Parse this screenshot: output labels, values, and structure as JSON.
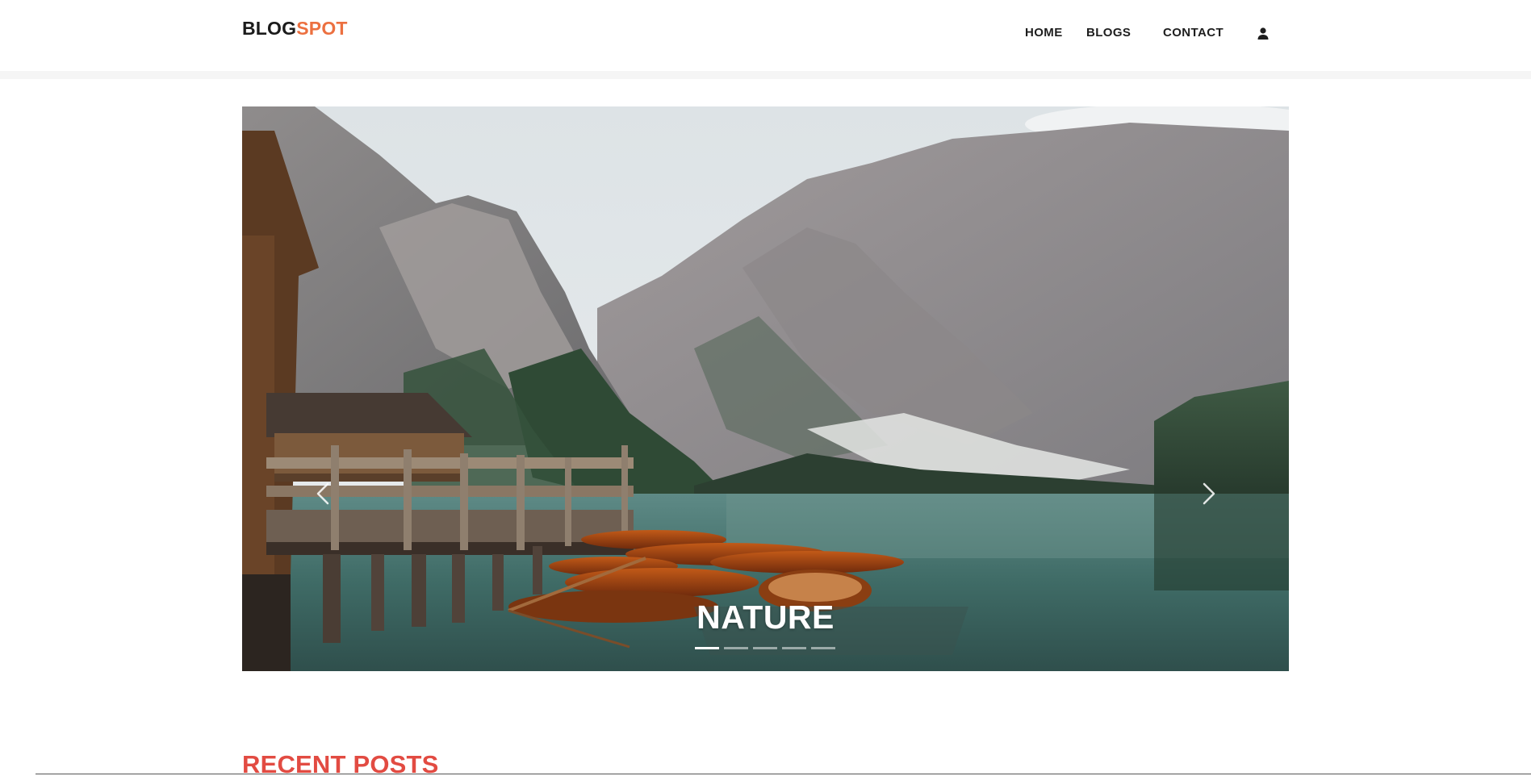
{
  "header": {
    "logo_part1": "BLOG",
    "logo_part2": "SPOT",
    "nav": {
      "home": "HOME",
      "blogs": "BLOGS",
      "contact": "CONTACT"
    },
    "user_icon": "user-icon"
  },
  "carousel": {
    "caption": "NATURE",
    "prev_icon": "chevron-left-icon",
    "next_icon": "chevron-right-icon",
    "slide_count": 5,
    "active_slide": 1
  },
  "recent_posts": {
    "title": "RECENT POSTS"
  },
  "colors": {
    "brand_accent": "#ec7040",
    "section_title": "#e24b42",
    "text_dark": "#1e1e1e"
  }
}
